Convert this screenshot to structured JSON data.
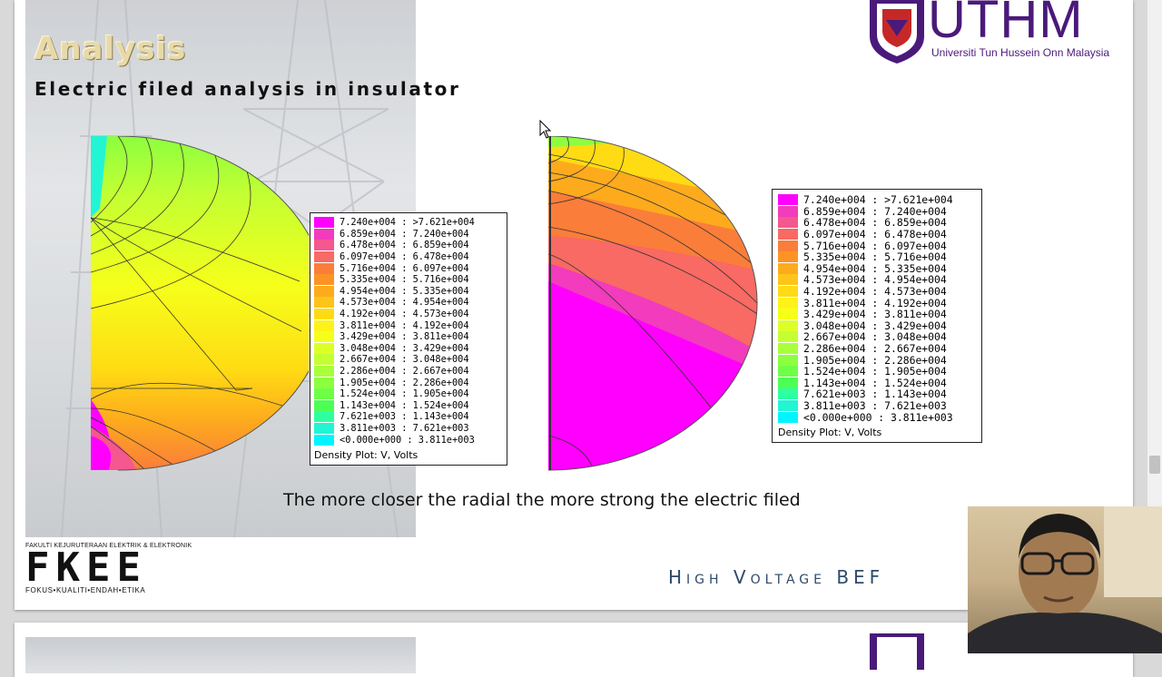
{
  "slide": {
    "title": "Analysis",
    "subtitle": "Electric filed analysis in insulator",
    "caption": "The more closer the radial the more strong the electric filed",
    "university_name": "UTHM",
    "university_subtitle": "Universiti Tun Hussein Onn Malaysia",
    "faculty_top": "FAKULTI KEJURUTERAAN ELEKTRIK & ELEKTRONIK",
    "faculty_logo": "FKEE",
    "faculty_motto": "FOKUS•KUALITI•ENDAH•ETIKA",
    "footer": "High Voltage BEF"
  },
  "legend": {
    "caption": "Density Plot: V, Volts",
    "entries": [
      {
        "label": "7.240e+004 : >7.621e+004",
        "color": "#ff00ff"
      },
      {
        "label": "6.859e+004 : 7.240e+004",
        "color": "#f23bbd"
      },
      {
        "label": "6.478e+004 : 6.859e+004",
        "color": "#f5578f"
      },
      {
        "label": "6.097e+004 : 6.478e+004",
        "color": "#f86a63"
      },
      {
        "label": "5.716e+004 : 6.097e+004",
        "color": "#fb7d3a"
      },
      {
        "label": "5.335e+004 : 5.716e+004",
        "color": "#fd9325"
      },
      {
        "label": "4.954e+004 : 5.335e+004",
        "color": "#fdab1d"
      },
      {
        "label": "4.573e+004 : 4.954e+004",
        "color": "#fec41a"
      },
      {
        "label": "4.192e+004 : 4.573e+004",
        "color": "#ffdb14"
      },
      {
        "label": "3.811e+004 : 4.192e+004",
        "color": "#fff21a"
      },
      {
        "label": "3.429e+004 : 3.811e+004",
        "color": "#f6ff1a"
      },
      {
        "label": "3.048e+004 : 3.429e+004",
        "color": "#ddff28"
      },
      {
        "label": "2.667e+004 : 3.048e+004",
        "color": "#c4ff32"
      },
      {
        "label": "2.286e+004 : 2.667e+004",
        "color": "#a9ff3a"
      },
      {
        "label": "1.905e+004 : 2.286e+004",
        "color": "#8cff3f"
      },
      {
        "label": "1.524e+004 : 1.905e+004",
        "color": "#6eff47"
      },
      {
        "label": "1.143e+004 : 1.524e+004",
        "color": "#4dff55"
      },
      {
        "label": "7.621e+003 : 1.143e+004",
        "color": "#2effa0"
      },
      {
        "label": "3.811e+003 : 7.621e+003",
        "color": "#22f5d4"
      },
      {
        "label": "<0.000e+000 : 3.811e+003",
        "color": "#00f5ff"
      }
    ]
  }
}
